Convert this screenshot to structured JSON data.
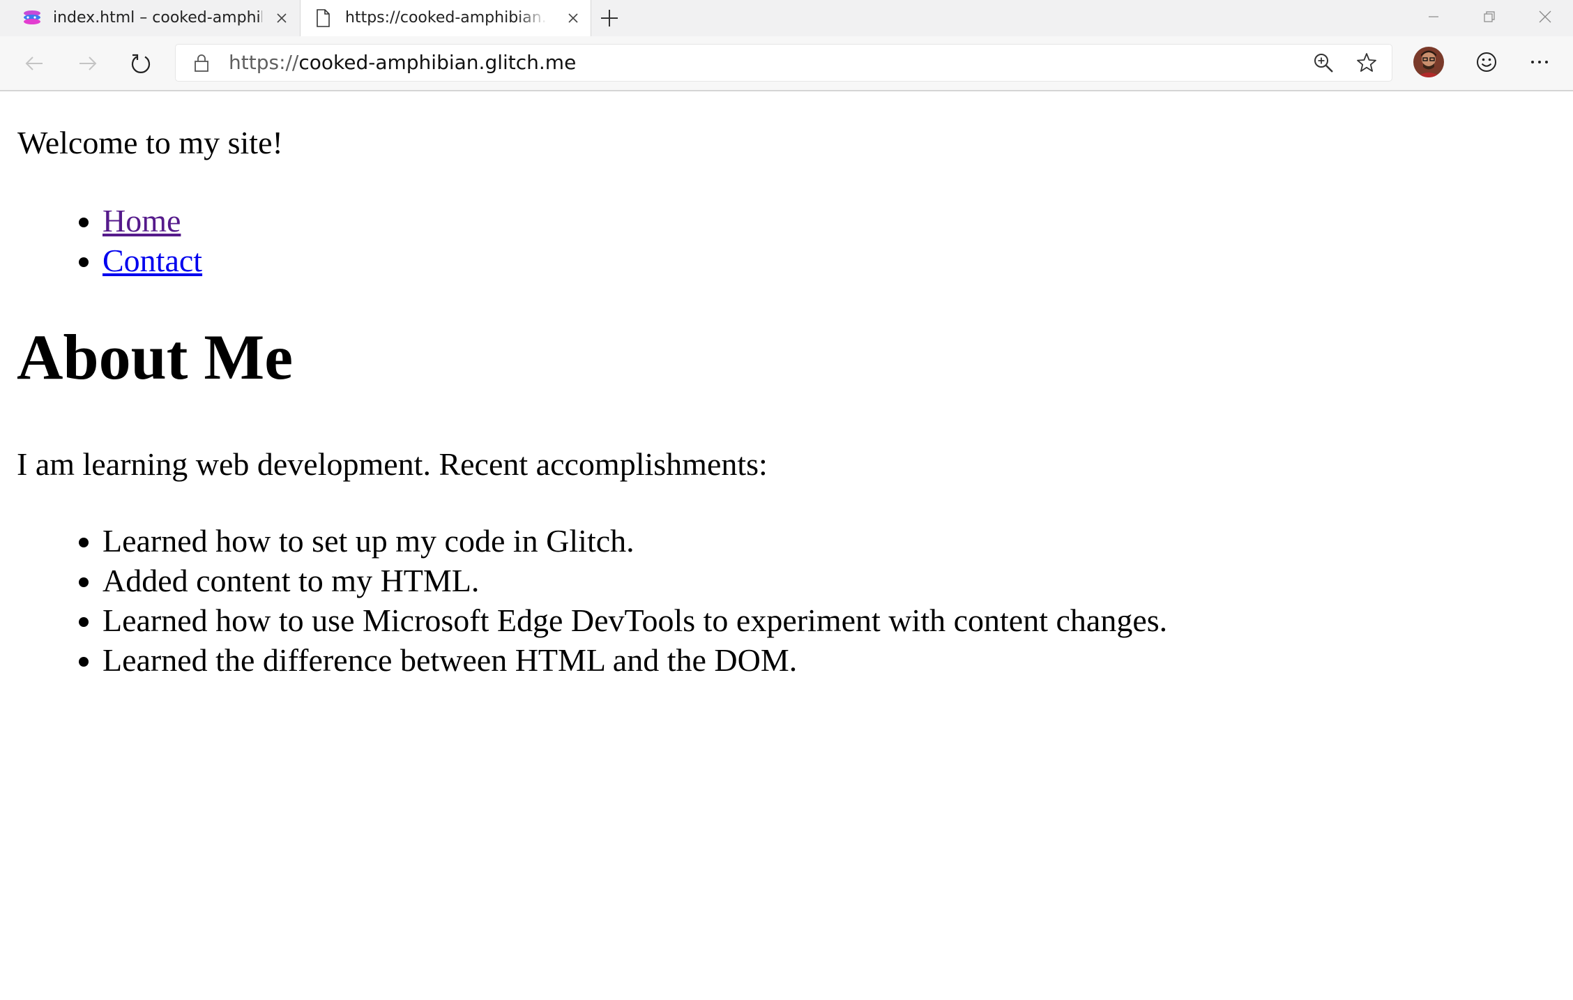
{
  "browser": {
    "tabs": [
      {
        "title": "index.html – cooked-amphibian",
        "favicon": "glitch-logo-icon",
        "active": false
      },
      {
        "title": "https://cooked-amphibian.glitch.me",
        "favicon": "page-icon",
        "active": true
      }
    ],
    "address_bar": {
      "scheme": "https://",
      "host": "cooked-amphibian.glitch.me"
    },
    "icons": {
      "back": "back-arrow-icon",
      "forward": "forward-arrow-icon",
      "reload": "reload-icon",
      "lock": "lock-icon",
      "zoom": "zoom-in-icon",
      "favorite": "star-icon",
      "feedback": "smiley-icon",
      "menu": "more-icon"
    }
  },
  "page": {
    "welcome": "Welcome to my site!",
    "nav_links": [
      {
        "label": "Home",
        "state": "visited"
      },
      {
        "label": "Contact",
        "state": "unvisited"
      }
    ],
    "heading": "About Me",
    "intro": "I am learning web development. Recent accomplishments:",
    "accomplishments": [
      "Learned how to set up my code in Glitch.",
      "Added content to my HTML.",
      "Learned how to use Microsoft Edge DevTools to experiment with content changes.",
      "Learned the difference between HTML and the DOM."
    ]
  },
  "colors": {
    "visited_link": "#551a8b",
    "unvisited_link": "#0000ee",
    "tabstrip_bg": "#f1f1f2",
    "toolbar_bg": "#f7f7f7"
  }
}
